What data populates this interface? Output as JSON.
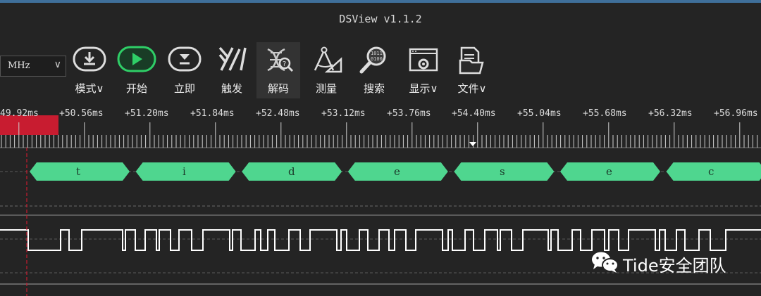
{
  "window": {
    "title": "DSView v1.1.2"
  },
  "sample_rate": {
    "value": "MHz"
  },
  "toolbar": {
    "mode": "模式",
    "start": "开始",
    "instant": "立即",
    "trigger": "触发",
    "decode": "解码",
    "measure": "测量",
    "search": "搜索",
    "display": "显示",
    "file": "文件"
  },
  "timeline": {
    "labels": [
      "49.92ms",
      "+50.56ms",
      "+51.20ms",
      "+51.84ms",
      "+52.48ms",
      "+53.12ms",
      "+53.76ms",
      "+54.40ms",
      "+55.04ms",
      "+55.68ms",
      "+56.32ms",
      "+56.96ms"
    ]
  },
  "decoder": {
    "cells": [
      "t",
      "i",
      "d",
      "e",
      "s",
      "e",
      "c"
    ],
    "color": "#4fd68f"
  },
  "watermark": {
    "text": "Tide安全团队"
  }
}
